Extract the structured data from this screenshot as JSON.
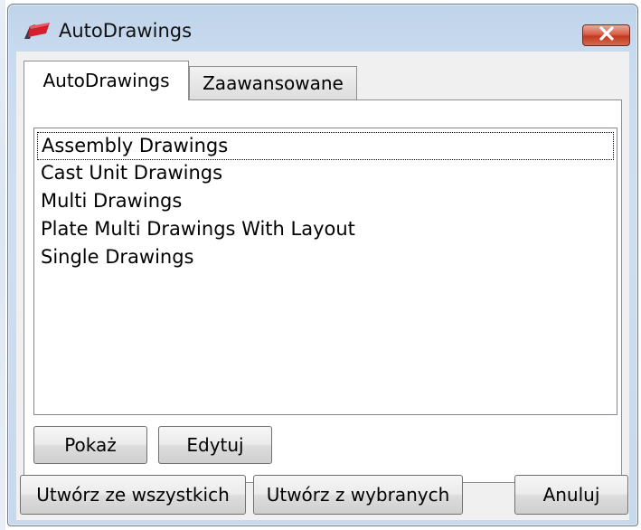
{
  "window": {
    "title": "AutoDrawings",
    "close_icon": "close-icon"
  },
  "tabs": [
    {
      "label": "AutoDrawings",
      "active": true
    },
    {
      "label": "Zaawansowane",
      "active": false
    }
  ],
  "list": {
    "items": [
      "Assembly Drawings",
      "Cast Unit Drawings",
      "Multi Drawings",
      "Plate Multi Drawings With Layout",
      "Single Drawings"
    ],
    "focused_index": 0
  },
  "panel_buttons": {
    "show": "Pokaż",
    "edit": "Edytuj"
  },
  "footer_buttons": {
    "create_all": "Utwórz ze wszystkich",
    "create_selected": "Utwórz z wybranych",
    "cancel": "Anuluj"
  },
  "colors": {
    "title_bar": "#c9dbef",
    "close_button": "#c94a32",
    "app_icon_red": "#d2202f",
    "app_icon_dark": "#3a3a4a"
  }
}
